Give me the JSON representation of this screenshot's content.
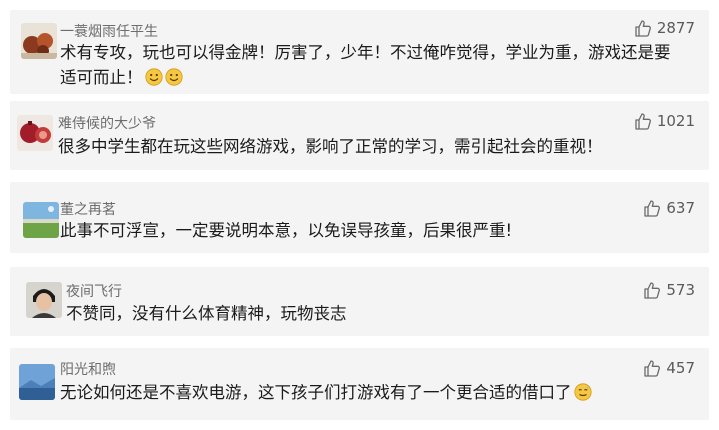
{
  "comments": [
    {
      "username": "一蓑烟雨任平生",
      "likes": "2877",
      "text": "术有专攻，玩也可以得金牌！厉害了，少年！不过俺咋觉得，学业为重，游戏还是要适可而止！",
      "avatar_icon": "fruit-photo-icon",
      "emoji": [
        "smile-emoji",
        "smile-emoji"
      ]
    },
    {
      "username": "难侍候的大少爷",
      "likes": "1021",
      "text": "很多中学生都在玩这些网络游戏，影响了正常的学习，需引起社会的重视！",
      "avatar_icon": "pomegranate-photo-icon"
    },
    {
      "username": "董之再茗",
      "likes": "637",
      "text": "此事不可浮宣，一定要说明本意，以免误导孩童，后果很严重!",
      "avatar_icon": "landscape-photo-icon"
    },
    {
      "username": "夜间飞行",
      "likes": "573",
      "text": "不赞同，没有什么体育精神，玩物丧志",
      "avatar_icon": "portrait-photo-icon"
    },
    {
      "username": "阳光和煦",
      "likes": "457",
      "text": "无论如何还是不喜欢电游，这下孩子们打游戏有了一个更合适的借口了",
      "avatar_icon": "sky-photo-icon",
      "emoji": [
        "awkward-smile-emoji"
      ]
    }
  ],
  "colors": {
    "card_bg": "#f4f4f4",
    "username": "#6d6d6d",
    "text": "#1a1a1a",
    "emoji": "#f5c742"
  }
}
